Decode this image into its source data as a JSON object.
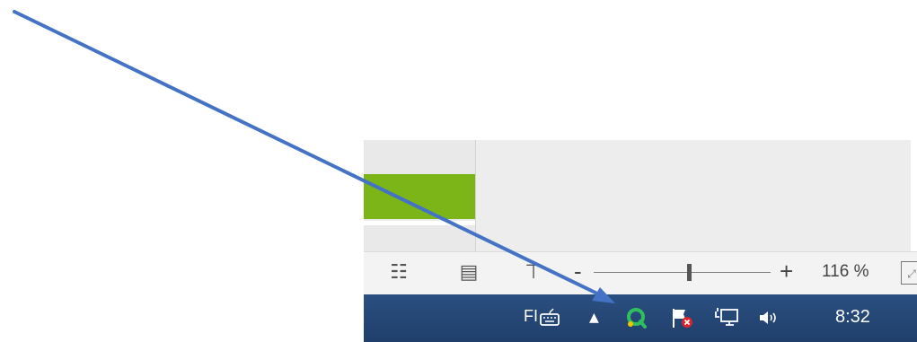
{
  "statusbar": {
    "view_buttons": [
      {
        "icon": "grid-view-icon"
      },
      {
        "icon": "reading-view-icon"
      },
      {
        "icon": "presentation-view-icon"
      }
    ],
    "zoom": {
      "minus_label": "-",
      "plus_label": "+",
      "percent_text": "116 %"
    },
    "fit_icon": "fit-to-window-icon"
  },
  "taskbar": {
    "language": "FI",
    "tray_icons": [
      "keyboard-icon",
      "show-hidden-icons-arrow",
      "app-tray-icon",
      "action-center-flag-icon",
      "network-icon",
      "volume-icon"
    ],
    "clock": "8:32"
  },
  "colors": {
    "accent_green": "#7cb518",
    "taskbar_blue": "#2a4f80",
    "arrow_blue": "#4472c4"
  },
  "annotation": {
    "type": "arrow",
    "points_to": "app-tray-icon"
  }
}
